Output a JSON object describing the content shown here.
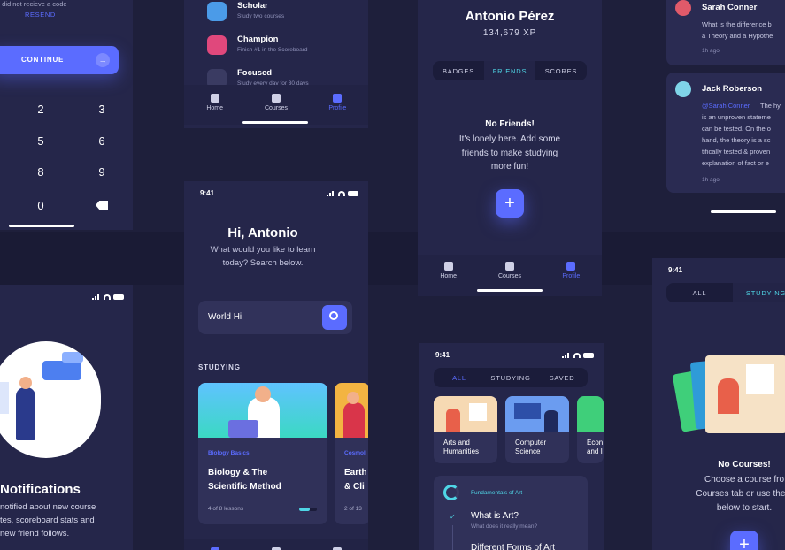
{
  "colors": {
    "accent": "#5b6cff",
    "teal": "#4fd6e6",
    "bg": "#1e1f3b",
    "card": "#25264a"
  },
  "otp": {
    "not_received": "I did not recieve a code",
    "resend": "RESEND",
    "continue": "CONTINUE",
    "keys": [
      "2",
      "3",
      "5",
      "6",
      "8",
      "9",
      "0"
    ],
    "backspace_icon": "backspace-icon"
  },
  "notifications": {
    "title": "Notifications",
    "lines": [
      "notified about new course",
      "tes, scoreboard stats and",
      "new friend follows."
    ]
  },
  "achievements": {
    "items": [
      {
        "title": "Scholar",
        "subtitle": "Study two courses",
        "icon": "scholar-badge-icon"
      },
      {
        "title": "Champion",
        "subtitle": "Finish #1 in the Scoreboard",
        "icon": "trophy-icon"
      },
      {
        "title": "Focused",
        "subtitle": "Study every day for 30 days",
        "icon": "focus-icon"
      }
    ],
    "tabs": [
      "Home",
      "Courses",
      "Profile"
    ]
  },
  "home": {
    "time": "9:41",
    "greeting": "Hi, Antonio",
    "prompt_line1": "What would you like to learn",
    "prompt_line2": "today? Search below.",
    "search_value": "World Hi",
    "section": "STUDYING",
    "course": {
      "category": "Biology Basics",
      "title_line1": "Biology & The",
      "title_line2": "Scientific Method",
      "progress_text": "4 of 8 lessons",
      "progress": 0.6
    },
    "course2": {
      "category": "Cosmol",
      "title_line1": "Earth",
      "title_line2": "& Cli",
      "progress_text": "2 of 13"
    }
  },
  "profile": {
    "name": "Antonio Pérez",
    "xp": "134,679 XP",
    "tabs": [
      "BADGES",
      "FRIENDS",
      "SCORES"
    ],
    "empty_title": "No Friends!",
    "empty_text": [
      "It's lonely here. Add some",
      "friends to make studying",
      "more fun!"
    ],
    "tabbar": [
      "Home",
      "Courses",
      "Profile"
    ]
  },
  "courses": {
    "time": "9:41",
    "tabs": [
      "ALL",
      "STUDYING",
      "SAVED"
    ],
    "cards": [
      {
        "line1": "Arts and",
        "line2": "Humanities"
      },
      {
        "line1": "Computer",
        "line2": "Science"
      },
      {
        "line1": "Econ",
        "line2": "and I"
      }
    ],
    "lesson_group": "Fundamentals of Art",
    "lesson1_title": "What is Art?",
    "lesson1_sub": "What does it really mean?",
    "lesson2_title": "Different Forms of Art"
  },
  "comments": {
    "items": [
      {
        "name": "Sarah Conner",
        "text": [
          "What is the difference b",
          "a Theory and a Hypothe"
        ],
        "time": "1h ago"
      },
      {
        "name": "Jack Roberson",
        "mention": "@Sarah Conner",
        "text": [
          "The hy",
          "is an unproven stateme",
          "can be tested. On the o",
          "hand, the theory is a sc",
          "tifically tested & proven",
          "explanation of fact or e"
        ],
        "time": "1h ago"
      }
    ]
  },
  "mycourses": {
    "time": "9:41",
    "tabs": [
      "ALL",
      "STUDYING"
    ],
    "empty_title": "No Courses!",
    "empty_text": [
      "Choose a course fro",
      "Courses tab or use the b",
      "below to start."
    ]
  }
}
